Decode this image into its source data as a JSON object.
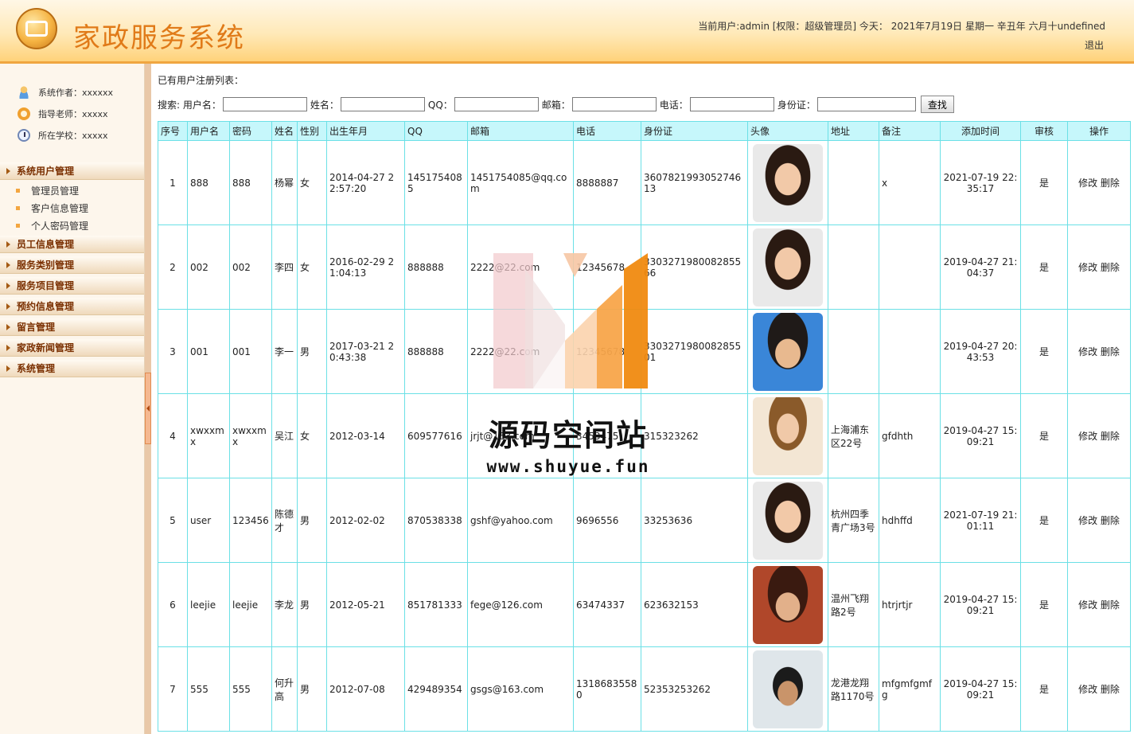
{
  "header": {
    "title": "家政服务系统",
    "user_info": "当前用户:admin [权限：超级管理员] 今天： 2021年7月19日 星期一 辛丑年 六月十undefined",
    "logout": "退出"
  },
  "sidebar": {
    "info": [
      {
        "label": "系统作者：xxxxxx",
        "icon": "user-icon"
      },
      {
        "label": "指导老师：xxxxx",
        "icon": "phone-icon"
      },
      {
        "label": "所在学校：xxxxx",
        "icon": "clock-icon"
      }
    ],
    "menu": {
      "system_users": "系统用户管理",
      "sub": [
        "管理员管理",
        "客户信息管理",
        "个人密码管理"
      ],
      "groups": [
        "员工信息管理",
        "服务类别管理",
        "服务项目管理",
        "预约信息管理",
        "留言管理",
        "家政新闻管理",
        "系统管理"
      ]
    }
  },
  "main": {
    "heading": "已有用户注册列表：",
    "search": {
      "prefix": "搜索: 用户名：",
      "labels": [
        "姓名：",
        "QQ：",
        "邮箱：",
        "电话：",
        "身份证："
      ],
      "button": "查找"
    },
    "columns": [
      "序号",
      "用户名",
      "密码",
      "姓名",
      "性别",
      "出生年月",
      "QQ",
      "邮箱",
      "电话",
      "身份证",
      "头像",
      "地址",
      "备注",
      "添加时间",
      "审核",
      "操作"
    ],
    "rows": [
      {
        "no": "1",
        "username": "888",
        "password": "888",
        "name": "杨幂",
        "gender": "女",
        "birth": "2014-04-27 22:57:20",
        "qq": "1451754085",
        "email": "1451754085@qq.com",
        "phone": "8888887",
        "idcard": "360782199305274613",
        "avatar": "female-avatar",
        "address": "",
        "note": "x",
        "added": "2021-07-19 22:35:17",
        "audit": "是"
      },
      {
        "no": "2",
        "username": "002",
        "password": "002",
        "name": "李四",
        "gender": "女",
        "birth": "2016-02-29 21:04:13",
        "qq": "888888",
        "email": "2222@22.com",
        "phone": "12345678",
        "idcard": "330327198008285566",
        "avatar": "female-avatar",
        "address": "",
        "note": "",
        "added": "2019-04-27 21:04:37",
        "audit": "是"
      },
      {
        "no": "3",
        "username": "001",
        "password": "001",
        "name": "李一",
        "gender": "男",
        "birth": "2017-03-21 20:43:38",
        "qq": "888888",
        "email": "2222@22.com",
        "phone": "12345678",
        "idcard": "330327198008285501",
        "avatar": "male-avatar-1",
        "address": "",
        "note": "",
        "added": "2019-04-27 20:43:53",
        "audit": "是"
      },
      {
        "no": "4",
        "username": "xwxxmx",
        "password": "xwxxmx",
        "name": "吴江",
        "gender": "女",
        "birth": "2012-03-14",
        "qq": "609577616",
        "email": "jrjt@163.com",
        "phone": "3453475",
        "idcard": "315323262",
        "avatar": "male-avatar-2",
        "address": "上海浦东区22号",
        "note": "gfdhth",
        "added": "2019-04-27 15:09:21",
        "audit": "是"
      },
      {
        "no": "5",
        "username": "user",
        "password": "123456",
        "name": "陈德才",
        "gender": "男",
        "birth": "2012-02-02",
        "qq": "870538338",
        "email": "gshf@yahoo.com",
        "phone": "9696556",
        "idcard": "33253636",
        "avatar": "female-avatar",
        "address": "杭州四季青广场3号",
        "note": "hdhffd",
        "added": "2021-07-19 21:01:11",
        "audit": "是"
      },
      {
        "no": "6",
        "username": "leejie",
        "password": "leejie",
        "name": "李龙",
        "gender": "男",
        "birth": "2012-05-21",
        "qq": "851781333",
        "email": "fege@126.com",
        "phone": "63474337",
        "idcard": "623632153",
        "avatar": "male-avatar-3",
        "address": "温州飞翔路2号",
        "note": "htrjrtjr",
        "added": "2019-04-27 15:09:21",
        "audit": "是"
      },
      {
        "no": "7",
        "username": "555",
        "password": "555",
        "name": "何升高",
        "gender": "男",
        "birth": "2012-07-08",
        "qq": "429489354",
        "email": "gsgs@163.com",
        "phone": "13186835580",
        "idcard": "52353253262",
        "avatar": "male-avatar-4",
        "address": "龙港龙翔路1170号",
        "note": "mfgmfgmfg",
        "added": "2019-04-27 15:09:21",
        "audit": "是"
      }
    ],
    "actions": {
      "edit": "修改",
      "delete": "删除"
    }
  },
  "watermark": {
    "title": "源码空间站",
    "url": "www.shuyue.fun"
  },
  "colors": {
    "accent": "#f0a640",
    "title": "#e07a18",
    "table_border": "#6be0e6",
    "table_header": "#c6f7fb"
  }
}
